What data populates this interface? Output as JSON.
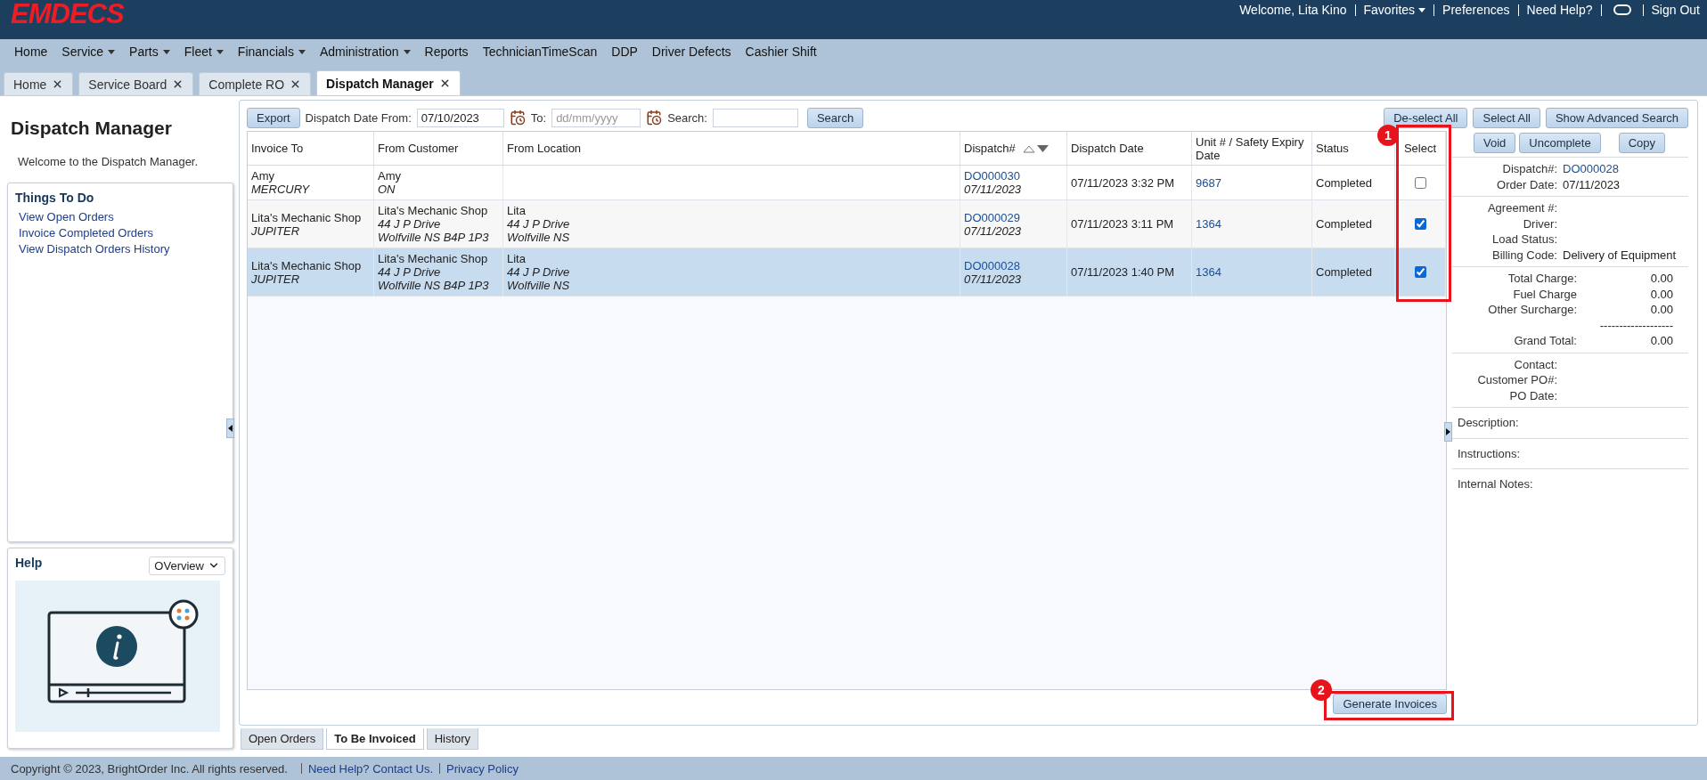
{
  "header": {
    "logo": "EMDECS",
    "welcome": "Welcome, Lita Kino",
    "links": [
      {
        "kind": "dropdown",
        "label": "Favorites"
      },
      {
        "kind": "link",
        "label": "Preferences"
      },
      {
        "kind": "link",
        "label": "Need Help?"
      },
      {
        "kind": "chat"
      },
      {
        "kind": "link",
        "label": "Sign Out"
      }
    ]
  },
  "menu": [
    {
      "label": "Home",
      "dropdown": false
    },
    {
      "label": "Service",
      "dropdown": true
    },
    {
      "label": "Parts",
      "dropdown": true
    },
    {
      "label": "Fleet",
      "dropdown": true
    },
    {
      "label": "Financials",
      "dropdown": true
    },
    {
      "label": "Administration",
      "dropdown": true
    },
    {
      "label": "Reports",
      "dropdown": false
    },
    {
      "label": "TechnicianTimeScan",
      "dropdown": false
    },
    {
      "label": "DDP",
      "dropdown": false
    },
    {
      "label": "Driver Defects",
      "dropdown": false
    },
    {
      "label": "Cashier Shift",
      "dropdown": false
    }
  ],
  "tabs": [
    {
      "label": "Home",
      "selected": false
    },
    {
      "label": "Service Board",
      "selected": false
    },
    {
      "label": "Complete RO",
      "selected": false
    },
    {
      "label": "Dispatch Manager",
      "selected": true
    }
  ],
  "sidebar": {
    "title": "Dispatch Manager",
    "welcome": "Welcome to the Dispatch Manager.",
    "todo": {
      "title": "Things To Do",
      "links": [
        "View Open Orders",
        "Invoice Completed Orders",
        "View Dispatch Orders History"
      ]
    },
    "help": {
      "title": "Help",
      "select": "OVerview"
    }
  },
  "toolbar": {
    "export": "Export",
    "date_from_label": "Dispatch Date From:",
    "date_from": "07/10/2023",
    "to_label": "To:",
    "to_placeholder": "dd/mm/yyyy",
    "search_label": "Search:",
    "search_button": "Search",
    "right_buttons": [
      "De-select All",
      "Select All",
      "Show Advanced Search"
    ]
  },
  "table": {
    "columns": [
      "Invoice To",
      "From Customer",
      "From Location",
      "Dispatch#",
      "Dispatch Date",
      "Unit # / Safety Expiry Date",
      "Status",
      "Select"
    ],
    "rows": [
      {
        "invoice_to": "Amy",
        "invoice_to_sub": "MERCURY",
        "from_customer": [
          "Amy",
          "ON"
        ],
        "from_location": [],
        "dispatch_no": "DO000030",
        "dispatch_sub": "07/11/2023",
        "dispatch_date": "07/11/2023 3:32 PM",
        "unit": "9687",
        "status": "Completed",
        "checked": false,
        "selected": false
      },
      {
        "invoice_to": "Lita's Mechanic Shop",
        "invoice_to_sub": "JUPITER",
        "from_customer": [
          "Lita's Mechanic Shop",
          "44 J P Drive",
          "Wolfville NS B4P 1P3"
        ],
        "from_location": [
          "Lita",
          "44 J P Drive",
          "Wolfville NS"
        ],
        "dispatch_no": "DO000029",
        "dispatch_sub": "07/11/2023",
        "dispatch_date": "07/11/2023 3:11 PM",
        "unit": "1364",
        "status": "Completed",
        "checked": true,
        "selected": false
      },
      {
        "invoice_to": "Lita's Mechanic Shop",
        "invoice_to_sub": "JUPITER",
        "from_customer": [
          "Lita's Mechanic Shop",
          "44 J P Drive",
          "Wolfville NS B4P 1P3"
        ],
        "from_location": [
          "Lita",
          "44 J P Drive",
          "Wolfville NS"
        ],
        "dispatch_no": "DO000028",
        "dispatch_sub": "07/11/2023",
        "dispatch_date": "07/11/2023 1:40 PM",
        "unit": "1364",
        "status": "Completed",
        "checked": true,
        "selected": true
      }
    ]
  },
  "actions": [
    "Void",
    "Uncomplete",
    "Copy"
  ],
  "details": {
    "sections": [
      {
        "rows": [
          {
            "kind": "field",
            "label": "Dispatch#:",
            "value": "DO000028",
            "link": true
          },
          {
            "kind": "field",
            "label": "Order Date:",
            "value": "07/11/2023",
            "link": false
          }
        ]
      },
      {
        "rows": [
          {
            "kind": "field",
            "label": "Agreement #:"
          },
          {
            "kind": "field",
            "label": "Driver:"
          },
          {
            "kind": "field",
            "label": "Load Status:"
          },
          {
            "kind": "field",
            "label": "Billing Code:",
            "value": "Delivery of Equipment",
            "link": false
          }
        ]
      },
      {
        "rows": [
          {
            "kind": "amount",
            "label": "Total Charge:",
            "value": "0.00"
          },
          {
            "kind": "amount",
            "label": "Fuel Charge",
            "value": "0.00"
          },
          {
            "kind": "amount",
            "label": "Other Surcharge:",
            "value": "0.00"
          },
          {
            "kind": "rule",
            "value": "-------------------"
          },
          {
            "kind": "amount",
            "label": "Grand Total:",
            "value": "0.00"
          }
        ]
      },
      {
        "rows": [
          {
            "kind": "field",
            "label": "Contact:"
          },
          {
            "kind": "field",
            "label": "Customer PO#:"
          },
          {
            "kind": "field",
            "label": "PO Date:"
          }
        ]
      },
      {
        "rows": [
          {
            "kind": "note",
            "label": "Description:"
          }
        ]
      },
      {
        "rows": [
          {
            "kind": "note",
            "label": "Instructions:"
          }
        ]
      },
      {
        "rows": [
          {
            "kind": "note",
            "label": "Internal Notes:"
          }
        ]
      }
    ]
  },
  "generate_button": "Generate Invoices",
  "bottom_tabs": [
    {
      "label": "Open Orders",
      "selected": false
    },
    {
      "label": "To Be Invoiced",
      "selected": true
    },
    {
      "label": "History",
      "selected": false
    }
  ],
  "footer": {
    "copyright": "Copyright © 2023, BrightOrder Inc. All rights reserved.",
    "links": [
      "Need Help? Contact Us.",
      "Privacy Policy"
    ]
  },
  "callouts": [
    {
      "label": "1"
    },
    {
      "label": "2"
    }
  ]
}
